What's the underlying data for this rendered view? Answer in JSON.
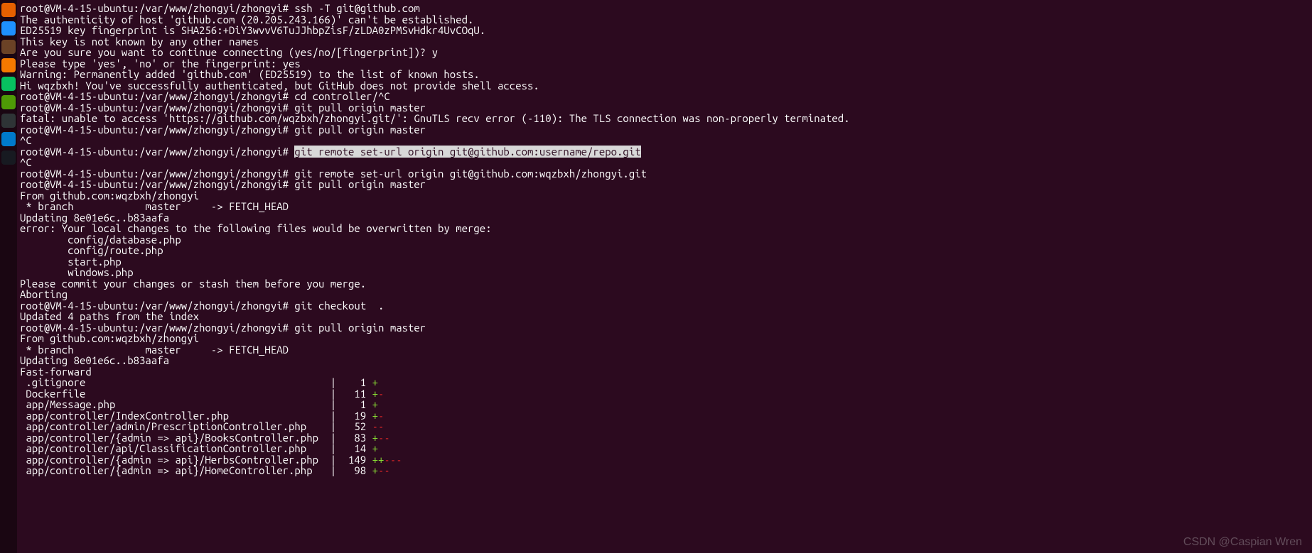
{
  "dock": {
    "items": [
      "firefox",
      "email",
      "files",
      "help",
      "wechat",
      "settings",
      "terminal",
      "vscode",
      "steam"
    ],
    "colors": [
      "#e66000",
      "#1e90ff",
      "#6b4226",
      "#f57900",
      "#07c160",
      "#4e9a06",
      "#2e3436",
      "#007acc",
      "#171a21"
    ]
  },
  "prompt": "root@VM-4-15-ubuntu:/var/www/zhongyi/zhongyi#",
  "lines": [
    {
      "t": "p",
      "cmd": " ssh -T git@github.com"
    },
    {
      "t": "o",
      "text": "The authenticity of host 'github.com (20.205.243.166)' can't be established."
    },
    {
      "t": "o",
      "text": "ED25519 key fingerprint is SHA256:+DiY3wvvV6TuJJhbpZisF/zLDA0zPMSvHdkr4UvCOqU."
    },
    {
      "t": "o",
      "text": "This key is not known by any other names"
    },
    {
      "t": "o",
      "text": "Are you sure you want to continue connecting (yes/no/[fingerprint])? y"
    },
    {
      "t": "o",
      "text": "Please type 'yes', 'no' or the fingerprint: yes"
    },
    {
      "t": "o",
      "text": "Warning: Permanently added 'github.com' (ED25519) to the list of known hosts."
    },
    {
      "t": "o",
      "text": "Hi wqzbxh! You've successfully authenticated, but GitHub does not provide shell access."
    },
    {
      "t": "p",
      "cmd": " cd controller/^C"
    },
    {
      "t": "p",
      "cmd": " git pull origin master"
    },
    {
      "t": "o",
      "text": "fatal: unable to access 'https://github.com/wqzbxh/zhongyi.git/': GnuTLS recv error (-110): The TLS connection was non-properly terminated."
    },
    {
      "t": "p",
      "cmd": " git pull origin master"
    },
    {
      "t": "o",
      "text": "^C"
    },
    {
      "t": "ph",
      "cmd": " ",
      "hl": "git remote set-url origin git@github.com:username/repo.git"
    },
    {
      "t": "o",
      "text": "^C"
    },
    {
      "t": "p",
      "cmd": " git remote set-url origin git@github.com:wqzbxh/zhongyi.git"
    },
    {
      "t": "p",
      "cmd": " git pull origin master"
    },
    {
      "t": "o",
      "text": "From github.com:wqzbxh/zhongyi"
    },
    {
      "t": "o",
      "text": " * branch            master     -> FETCH_HEAD"
    },
    {
      "t": "o",
      "text": "Updating 8e01e6c..b83aafa"
    },
    {
      "t": "o",
      "text": "error: Your local changes to the following files would be overwritten by merge:"
    },
    {
      "t": "o",
      "text": "        config/database.php"
    },
    {
      "t": "o",
      "text": "        config/route.php"
    },
    {
      "t": "o",
      "text": "        start.php"
    },
    {
      "t": "o",
      "text": "        windows.php"
    },
    {
      "t": "o",
      "text": "Please commit your changes or stash them before you merge."
    },
    {
      "t": "o",
      "text": "Aborting"
    },
    {
      "t": "p",
      "cmd": " git checkout  ."
    },
    {
      "t": "o",
      "text": "Updated 4 paths from the index"
    },
    {
      "t": "p",
      "cmd": " git pull origin master"
    },
    {
      "t": "o",
      "text": "From github.com:wqzbxh/zhongyi"
    },
    {
      "t": "o",
      "text": " * branch            master     -> FETCH_HEAD"
    },
    {
      "t": "o",
      "text": "Updating 8e01e6c..b83aafa"
    },
    {
      "t": "o",
      "text": "Fast-forward"
    },
    {
      "t": "d",
      "file": " .gitignore                                         |    1 ",
      "p": "+",
      "m": ""
    },
    {
      "t": "d",
      "file": " Dockerfile                                         |   11 ",
      "p": "+",
      "m": "-"
    },
    {
      "t": "d",
      "file": " app/Message.php                                    |    1 ",
      "p": "+",
      "m": ""
    },
    {
      "t": "d",
      "file": " app/controller/IndexController.php                 |   19 ",
      "p": "+",
      "m": "-"
    },
    {
      "t": "d",
      "file": " app/controller/admin/PrescriptionController.php    |   52 ",
      "p": "",
      "m": "--"
    },
    {
      "t": "d",
      "file": " app/controller/{admin => api}/BooksController.php  |   83 ",
      "p": "+",
      "m": "--"
    },
    {
      "t": "d",
      "file": " app/controller/api/ClassificationController.php    |   14 ",
      "p": "+",
      "m": ""
    },
    {
      "t": "d",
      "file": " app/controller/{admin => api}/HerbsController.php  |  149 ",
      "p": "++",
      "m": "---"
    },
    {
      "t": "d",
      "file": " app/controller/{admin => api}/HomeController.php   |   98 ",
      "p": "+",
      "m": "--"
    }
  ],
  "watermark": "CSDN @Caspian Wren"
}
